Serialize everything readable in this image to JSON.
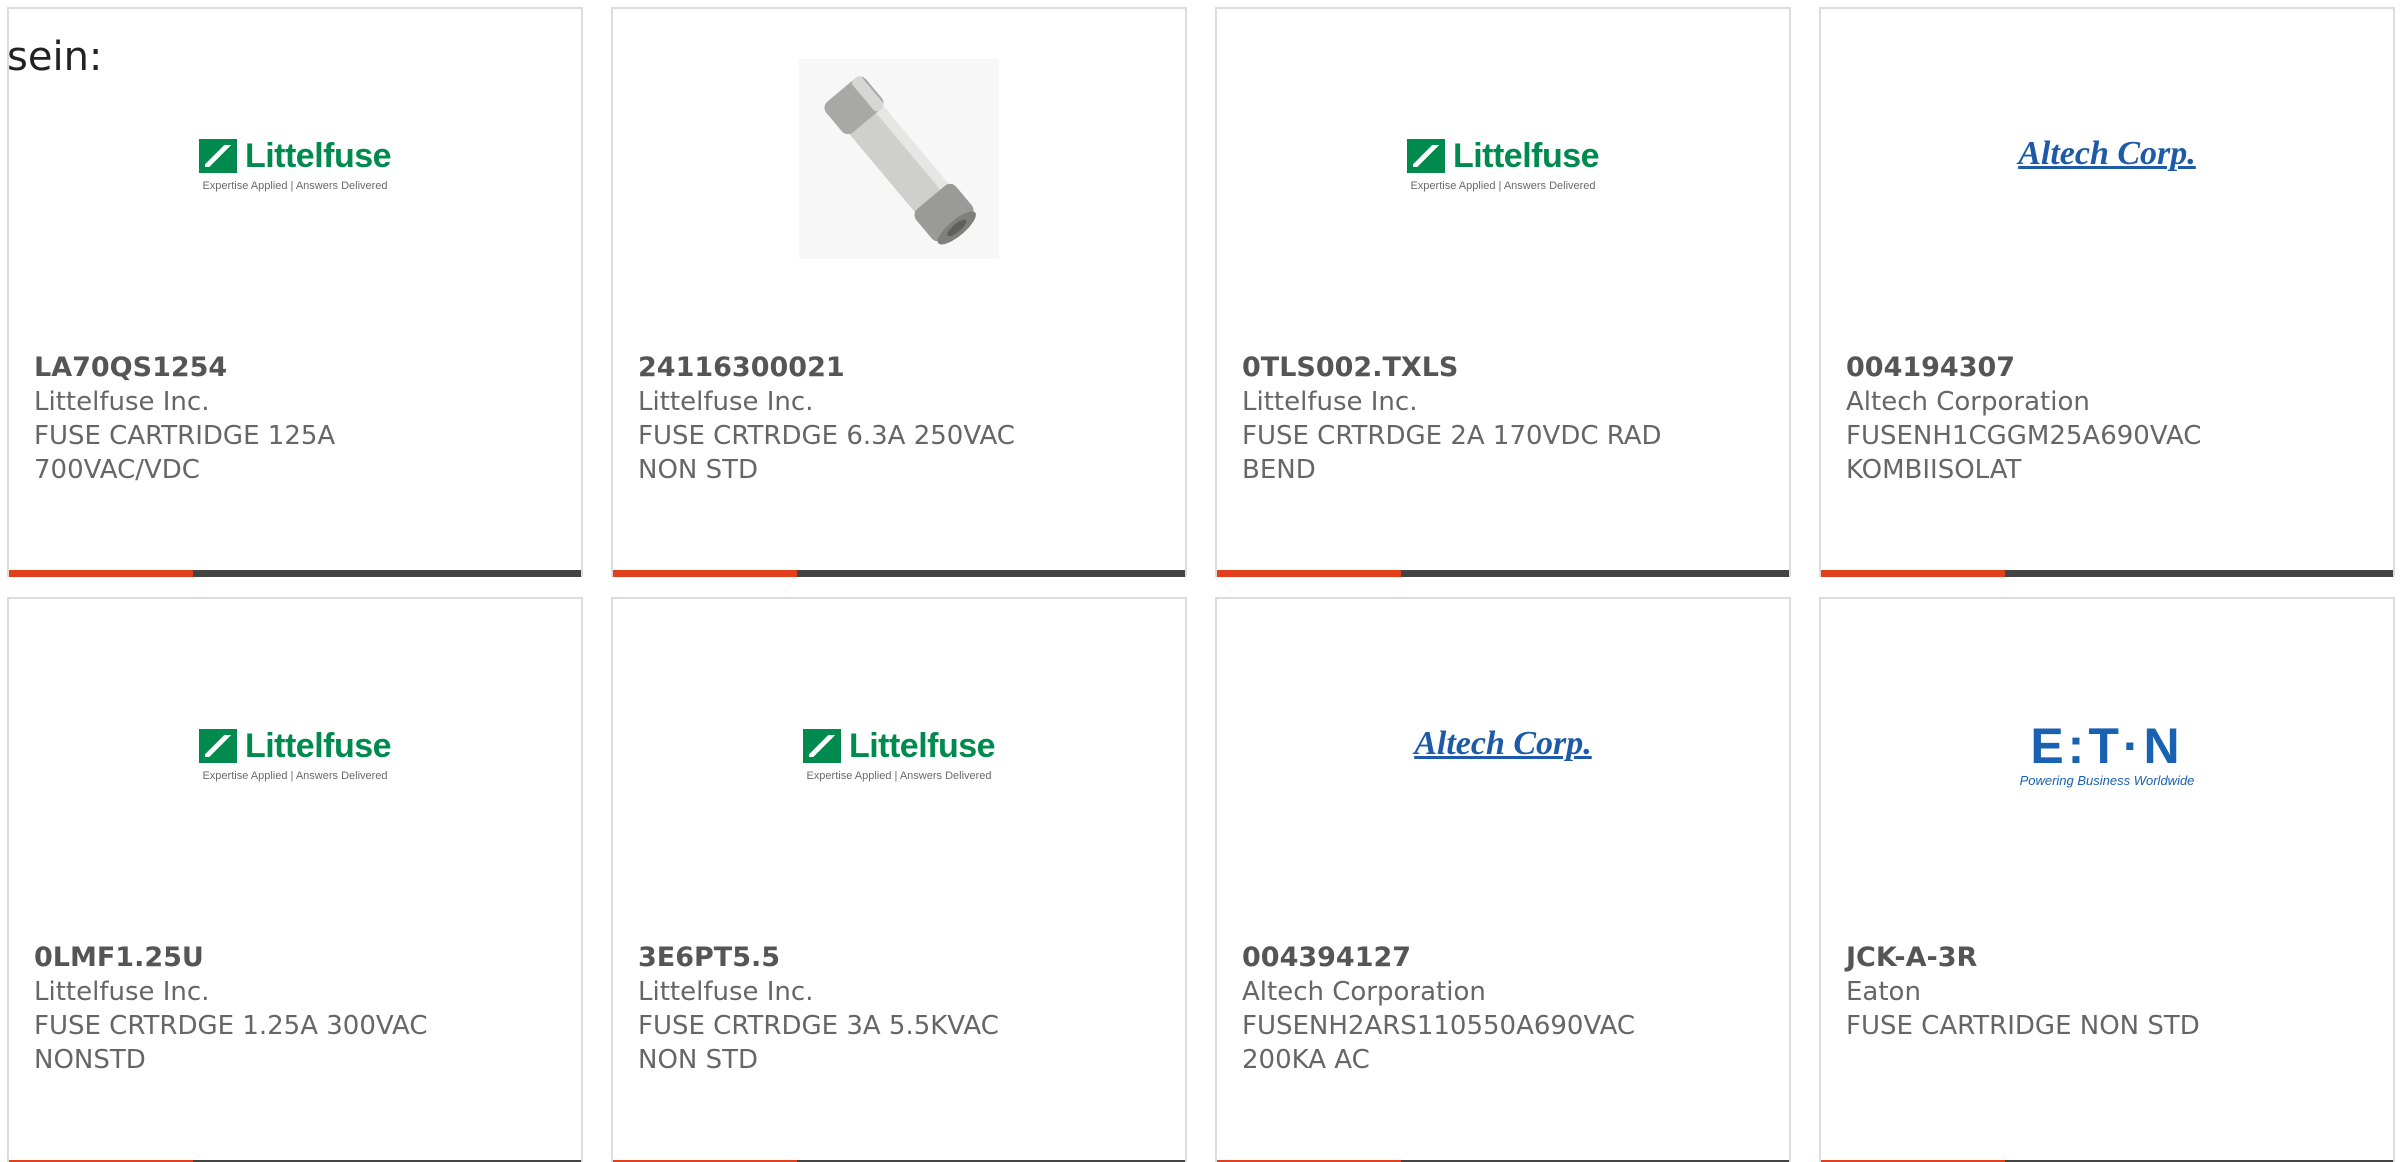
{
  "page": {
    "lead_text": "sein:"
  },
  "colors": {
    "accent": "#e2401c",
    "bar": "#444444",
    "littelfuse_green": "#008a4e",
    "altech_blue": "#1d5aa8",
    "eaton_blue": "#1961b1"
  },
  "logos": {
    "littelfuse": {
      "word": "Littelfuse",
      "tagline": "Expertise Applied | Answers Delivered"
    },
    "altech": {
      "word": "Altech Corp."
    },
    "eaton": {
      "word": "E:T·N",
      "tagline": "Powering Business Worldwide"
    }
  },
  "products": [
    {
      "part_number": "LA70QS1254",
      "manufacturer": "Littelfuse Inc.",
      "description": "FUSE CARTRIDGE 125A 700VAC/VDC",
      "image": "littelfuse-logo"
    },
    {
      "part_number": "24116300021",
      "manufacturer": "Littelfuse Inc.",
      "description": "FUSE CRTRDGE 6.3A 250VAC NON STD",
      "image": "fuse-photo"
    },
    {
      "part_number": "0TLS002.TXLS",
      "manufacturer": "Littelfuse Inc.",
      "description": "FUSE CRTRDGE 2A 170VDC RAD BEND",
      "image": "littelfuse-logo"
    },
    {
      "part_number": "004194307",
      "manufacturer": "Altech Corporation",
      "description": "FUSENH1CGGM25A690VAC KOMBIISOLAT",
      "image": "altech-logo"
    },
    {
      "part_number": "0LMF1.25U",
      "manufacturer": "Littelfuse Inc.",
      "description": "FUSE CRTRDGE 1.25A 300VAC NONSTD",
      "image": "littelfuse-logo"
    },
    {
      "part_number": "3E6PT5.5",
      "manufacturer": "Littelfuse Inc.",
      "description": "FUSE CRTRDGE 3A 5.5KVAC NON STD",
      "image": "littelfuse-logo"
    },
    {
      "part_number": "004394127",
      "manufacturer": "Altech Corporation",
      "description": "FUSENH2ARS110550A690VAC 200KA AC",
      "image": "altech-logo"
    },
    {
      "part_number": "JCK-A-3R",
      "manufacturer": "Eaton",
      "description": "FUSE CARTRIDGE NON STD",
      "image": "eaton-logo"
    }
  ]
}
